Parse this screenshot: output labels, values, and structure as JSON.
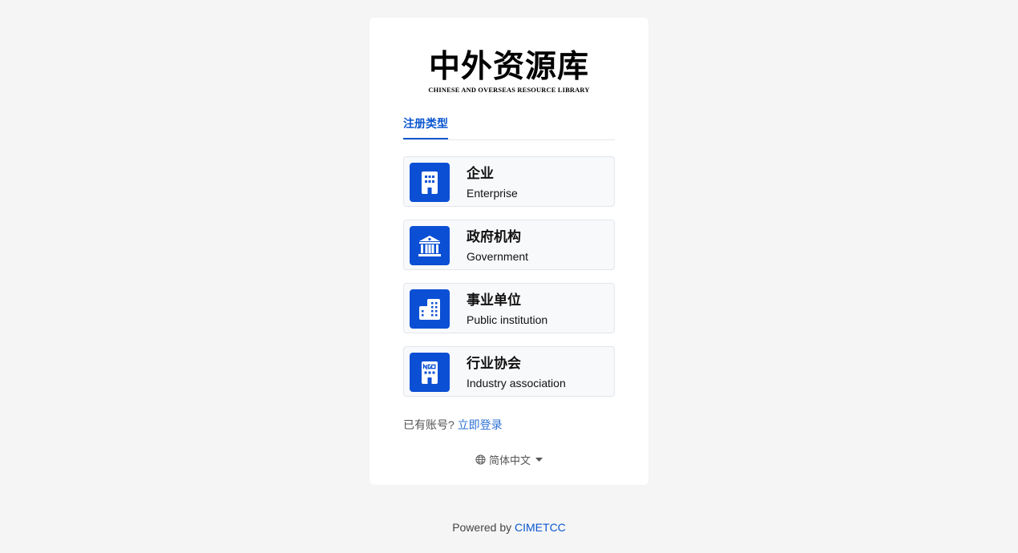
{
  "logo": {
    "title_cn": "中外资源库",
    "title_en": "CHINESE AND OVERSEAS RESOURCE LIBRARY"
  },
  "tabs": [
    {
      "label": "注册类型",
      "active": true
    }
  ],
  "options": [
    {
      "title": "企业",
      "subtitle": "Enterprise",
      "icon": "building-icon"
    },
    {
      "title": "政府机构",
      "subtitle": "Government",
      "icon": "government-icon"
    },
    {
      "title": "事业单位",
      "subtitle": "Public institution",
      "icon": "institution-icon"
    },
    {
      "title": "行业协会",
      "subtitle": "Industry association",
      "icon": "ngo-icon"
    }
  ],
  "login": {
    "prompt": "已有账号?",
    "link": "立即登录"
  },
  "language": {
    "selected": "简体中文",
    "icon": "globe-icon"
  },
  "footer": {
    "prefix": "Powered by ",
    "brand": "CIMETCC"
  },
  "colors": {
    "accent": "#0b57d0",
    "icon_bg": "#0b4fd4",
    "link": "#2b6fd6"
  }
}
